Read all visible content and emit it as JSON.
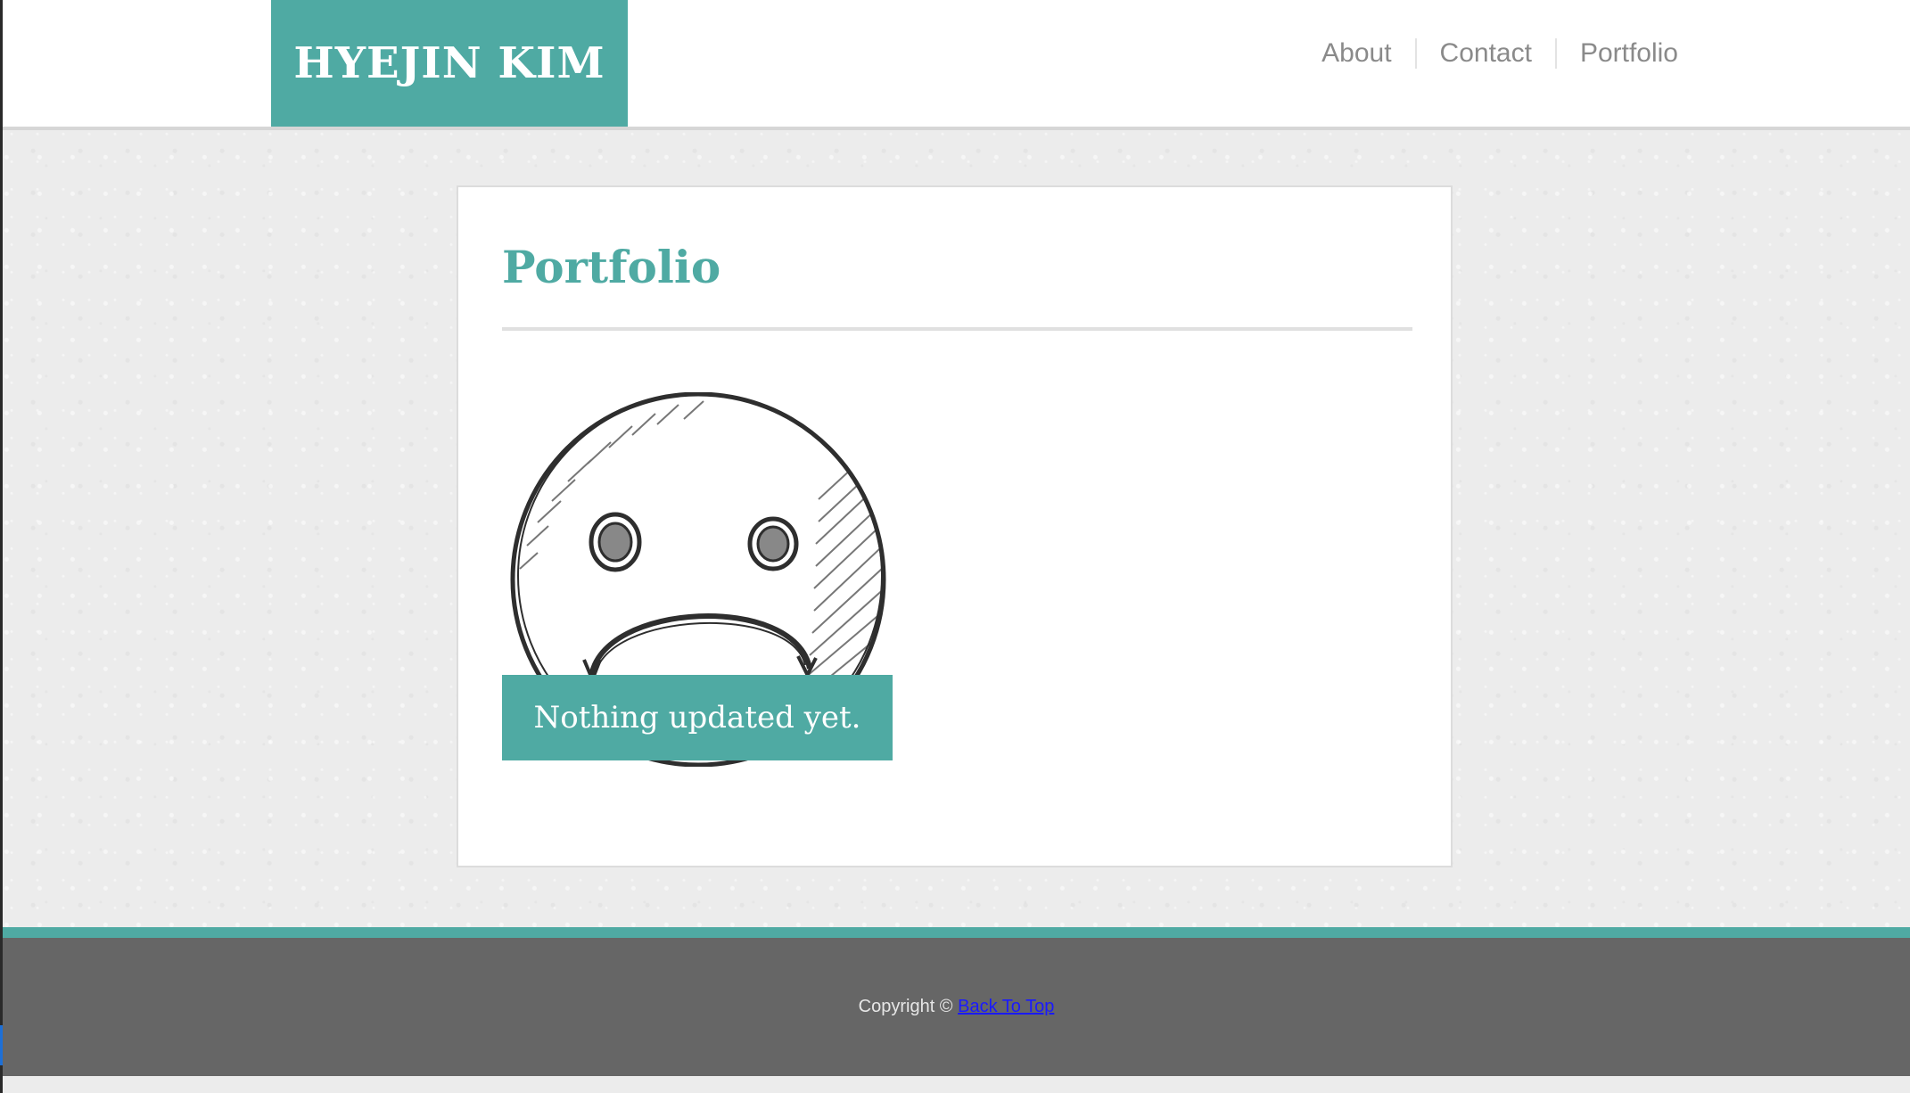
{
  "header": {
    "logo": "HYEJIN KIM",
    "nav": [
      {
        "label": "About"
      },
      {
        "label": "Contact"
      },
      {
        "label": "Portfolio"
      }
    ]
  },
  "main": {
    "title": "Portfolio",
    "illustration_icon": "sad-face-sketch-icon",
    "status_message": "Nothing updated yet."
  },
  "footer": {
    "copyright": "Copyright ©",
    "back_to_top": "Back To Top"
  },
  "colors": {
    "accent": "#4faaa3",
    "nav_text": "#8a8a8a",
    "footer_bg": "#666666",
    "page_bg": "#ececec",
    "link": "#1a1aff"
  }
}
